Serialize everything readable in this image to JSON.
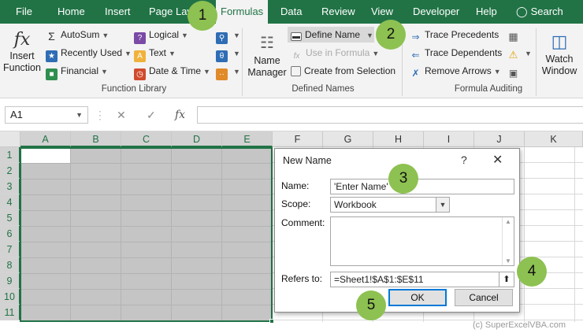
{
  "tabs": [
    "File",
    "Home",
    "Insert",
    "Page Layout",
    "Formulas",
    "Data",
    "Review",
    "View",
    "Developer",
    "Help"
  ],
  "search_label": "Search",
  "ribbon": {
    "insert_function": [
      "Insert",
      "Function"
    ],
    "function_library": {
      "label": "Function Library",
      "autosum": "AutoSum",
      "recently_used": "Recently Used",
      "financial": "Financial",
      "logical": "Logical",
      "text": "Text",
      "date_time": "Date & Time"
    },
    "defined_names": {
      "label": "Defined Names",
      "name_manager": [
        "Name",
        "Manager"
      ],
      "define_name": "Define Name",
      "use_in_formula": "Use in Formula",
      "create_from_selection": "Create from Selection"
    },
    "formula_auditing": {
      "label": "Formula Auditing",
      "trace_precedents": "Trace Precedents",
      "trace_dependents": "Trace Dependents",
      "remove_arrows": "Remove Arrows",
      "watch_window": [
        "Watch",
        "Window"
      ]
    }
  },
  "formula_bar": {
    "name_box": "A1",
    "content": ""
  },
  "columns": [
    "A",
    "B",
    "C",
    "D",
    "E",
    "F",
    "G",
    "H",
    "I",
    "J",
    "K"
  ],
  "rows": [
    "1",
    "2",
    "3",
    "4",
    "5",
    "6",
    "7",
    "8",
    "9",
    "10",
    "11"
  ],
  "dialog": {
    "title": "New Name",
    "help": "?",
    "name_label": "Name:",
    "name_value": "'Enter Name'",
    "scope_label": "Scope:",
    "scope_value": "Workbook",
    "comment_label": "Comment:",
    "comment_value": "",
    "refers_label": "Refers to:",
    "refers_value": "=Sheet1!$A$1:$E$11",
    "ok": "OK",
    "cancel": "Cancel"
  },
  "callouts": [
    "1",
    "2",
    "3",
    "4",
    "5"
  ],
  "copyright": "(c) SuperExcelVBA.com",
  "colors": {
    "excel_green": "#217346",
    "callout_green": "#8dc151",
    "selection_gray": "#c5c5c5"
  }
}
